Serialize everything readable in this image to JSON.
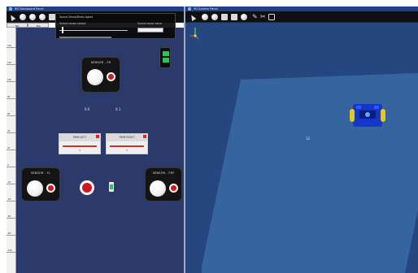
{
  "windows": {
    "left_title": "6N Dashboard Panel",
    "right_title": "3D System Panel"
  },
  "tabs": [
    "Tab",
    "Tab"
  ],
  "ruler_ticks": [
    "140",
    "120",
    "100",
    "80",
    "60",
    "40",
    "20",
    "0",
    "-20",
    "-40",
    "-60",
    "-80",
    "-100"
  ],
  "overlay": {
    "title": "Sound Sense/Dress Agent",
    "left_label": "Sound sense control",
    "right_label": "Sound sense value"
  },
  "dashboard": {
    "top_panel_label": "SENSOR - FR",
    "left_panel_label": "SENSOR - FL",
    "right_panel_label": "SENSOR - FRT",
    "value_left": "0.0",
    "value_right": "0.1",
    "pwm_left_title": "PWM LEFT",
    "pwm_right_title": "PWM RIGHT",
    "pwm_sub": "0"
  },
  "scene": {
    "label": "12"
  },
  "icons": {
    "robot": "robot-icon",
    "battery": "battery-icon",
    "axes": "axes-gizmo-icon"
  },
  "colors": {
    "dashboard_bg": "#2b3a6b",
    "scene_bg": "#25467f",
    "floor": "#3a6aa3",
    "led_red": "#d0171f",
    "battery_green": "#29c55a",
    "robot_blue": "#1436c9",
    "robot_wheel": "#e2c81f"
  }
}
